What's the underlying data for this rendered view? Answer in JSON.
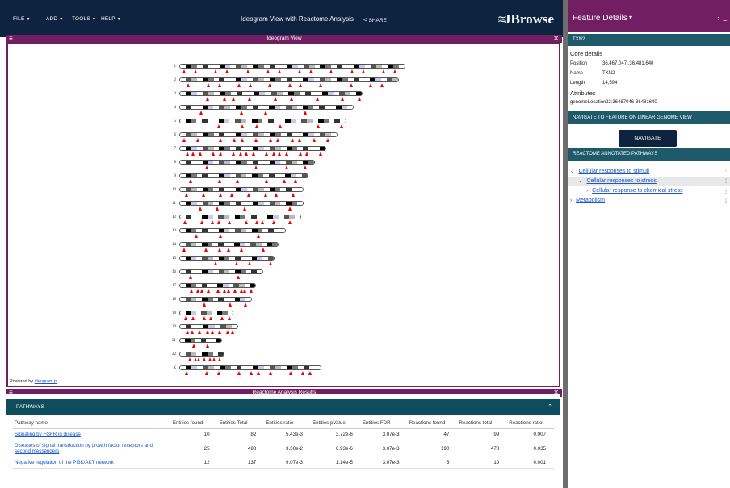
{
  "topbar": {
    "menus": [
      {
        "label": "FILE"
      },
      {
        "label": "ADD"
      },
      {
        "label": "TOOLS"
      },
      {
        "label": "HELP"
      }
    ],
    "title": "Ideogram View with Reactome Analysis",
    "share_label": "SHARE",
    "logo": "JBrowse"
  },
  "ideogram_panel": {
    "title": "Ideogram View",
    "powered_prefix": "Powered by ",
    "powered_link": "ideogram.js",
    "chromosomes": [
      {
        "label": "1",
        "len": 1.0,
        "tri": 14
      },
      {
        "label": "2",
        "len": 0.97,
        "tri": 12
      },
      {
        "label": "3",
        "len": 0.81,
        "tri": 9
      },
      {
        "label": "4",
        "len": 0.77,
        "tri": 4
      },
      {
        "label": "5",
        "len": 0.74,
        "tri": 6
      },
      {
        "label": "6",
        "len": 0.7,
        "tri": 12
      },
      {
        "label": "7",
        "len": 0.65,
        "tri": 16
      },
      {
        "label": "8",
        "len": 0.6,
        "tri": 4
      },
      {
        "label": "9",
        "len": 0.57,
        "tri": 6
      },
      {
        "label": "10",
        "len": 0.55,
        "tri": 8
      },
      {
        "label": "11",
        "len": 0.55,
        "tri": 4
      },
      {
        "label": "12",
        "len": 0.54,
        "tri": 10
      },
      {
        "label": "13",
        "len": 0.47,
        "tri": 3
      },
      {
        "label": "14",
        "len": 0.44,
        "tri": 6
      },
      {
        "label": "15",
        "len": 0.42,
        "tri": 4
      },
      {
        "label": "16",
        "len": 0.37,
        "tri": 2
      },
      {
        "label": "17",
        "len": 0.34,
        "tri": 11
      },
      {
        "label": "18",
        "len": 0.32,
        "tri": 3
      },
      {
        "label": "19",
        "len": 0.24,
        "tri": 6
      },
      {
        "label": "20",
        "len": 0.26,
        "tri": 8
      },
      {
        "label": "21",
        "len": 0.19,
        "tri": 2
      },
      {
        "label": "22",
        "len": 0.2,
        "tri": 7
      },
      {
        "label": "X",
        "len": 0.63,
        "tri": 10
      }
    ]
  },
  "results_panel": {
    "title": "Reactome Analysis Results",
    "section": "PATHWAYS",
    "columns": [
      "Pathway name",
      "Entities found",
      "Entities Total",
      "Entities ratio",
      "Entities pValue",
      "Entities FDR",
      "Reactions found",
      "Reactions total",
      "Reactions ratio"
    ],
    "rows": [
      [
        "Signaling by FGFR in disease",
        "10",
        "82",
        "5.43e-3",
        "3.72e-6",
        "3.07e-3",
        "47",
        "99",
        "0.007"
      ],
      [
        "Diseases of signal transduction by growth factor receptors and second messengers",
        "25",
        "498",
        "3.30e-2",
        "6.93e-6",
        "3.07e-3",
        "190",
        "478",
        "0.035"
      ],
      [
        "Negative regulation of the PI3K/AKT network",
        "12",
        "137",
        "9.07e-3",
        "1.14e-5",
        "3.07e-3",
        "6",
        "10",
        "0.001"
      ]
    ]
  },
  "drawer": {
    "title": "Feature Details",
    "feature_name": "TXN2",
    "core_title": "Core details",
    "core": [
      {
        "k": "Position",
        "v": "36,467,047..36,481,640"
      },
      {
        "k": "Name",
        "v": "TXN2"
      },
      {
        "k": "Length",
        "v": "14,594"
      }
    ],
    "attr_title": "Attributes",
    "attrs": [
      {
        "k": "genomeLocation",
        "v": "22:36467046-36481640"
      }
    ],
    "navigate_header": "NAVIGATE TO FEATURE ON LINEAR GENOME VIEW",
    "navigate_button": "NAVIGATE",
    "reactome_header": "REACTOME ANNOTATED PATHWAYS",
    "tree": [
      {
        "label": "Cellular responses to stimuli",
        "chev": "⌄"
      },
      {
        "label": "Cellular responses to stress",
        "chev": "⌄"
      },
      {
        "label": "Cellular response to chemical stress",
        "chev": "›"
      },
      {
        "label": "Metabolism",
        "chev": "›"
      }
    ]
  },
  "colors": {
    "appbar": "#0d233f",
    "panel_bar": "#721e63",
    "teal": "#0f4d5e",
    "marker": "#e00000",
    "link": "#1a57c9"
  }
}
